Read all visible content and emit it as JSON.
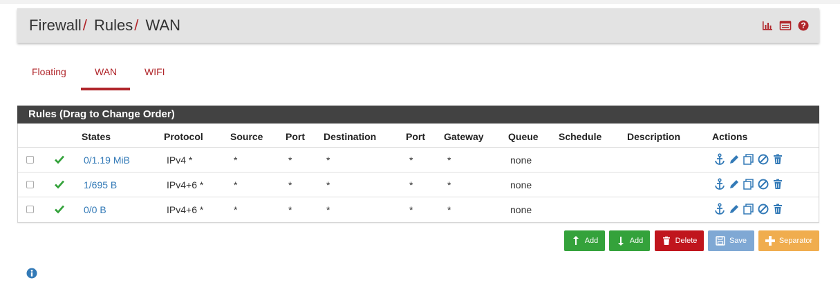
{
  "breadcrumb": {
    "part1": "Firewall",
    "sep1": "/",
    "part2": "Rules",
    "sep2": "/",
    "part3": "WAN"
  },
  "header_icons": [
    "bar-chart-icon",
    "list-icon",
    "help-icon"
  ],
  "tabs": [
    {
      "label": "Floating",
      "active": false
    },
    {
      "label": "WAN",
      "active": true
    },
    {
      "label": "WIFI",
      "active": false
    }
  ],
  "panel": {
    "title": "Rules (Drag to Change Order)"
  },
  "columns": {
    "states": "States",
    "protocol": "Protocol",
    "source": "Source",
    "port": "Port",
    "destination": "Destination",
    "port2": "Port",
    "gateway": "Gateway",
    "queue": "Queue",
    "schedule": "Schedule",
    "description": "Description",
    "actions": "Actions"
  },
  "rules": [
    {
      "states": "0/1.19 MiB",
      "protocol": "IPv4 *",
      "source": "*",
      "port": "*",
      "destination": "*",
      "port2": "*",
      "gateway": "*",
      "queue": "none",
      "schedule": "",
      "description": ""
    },
    {
      "states": "1/695 B",
      "protocol": "IPv4+6 *",
      "source": "*",
      "port": "*",
      "destination": "*",
      "port2": "*",
      "gateway": "*",
      "queue": "none",
      "schedule": "",
      "description": ""
    },
    {
      "states": "0/0 B",
      "protocol": "IPv4+6 *",
      "source": "*",
      "port": "*",
      "destination": "*",
      "port2": "*",
      "gateway": "*",
      "queue": "none",
      "schedule": "",
      "description": ""
    }
  ],
  "row_actions": [
    "anchor-icon",
    "pencil-icon",
    "copy-icon",
    "disable-icon",
    "trash-icon"
  ],
  "buttons": {
    "add_top": "Add",
    "add_bottom": "Add",
    "delete": "Delete",
    "save": "Save",
    "separator": "Separator"
  },
  "colors": {
    "accent": "#b0252a",
    "panel_header": "#424242",
    "link": "#337ab7",
    "success": "#34a23b",
    "danger": "#c0151d",
    "primary_disabled": "#7fa8d4",
    "warning": "#f0ad4e"
  }
}
